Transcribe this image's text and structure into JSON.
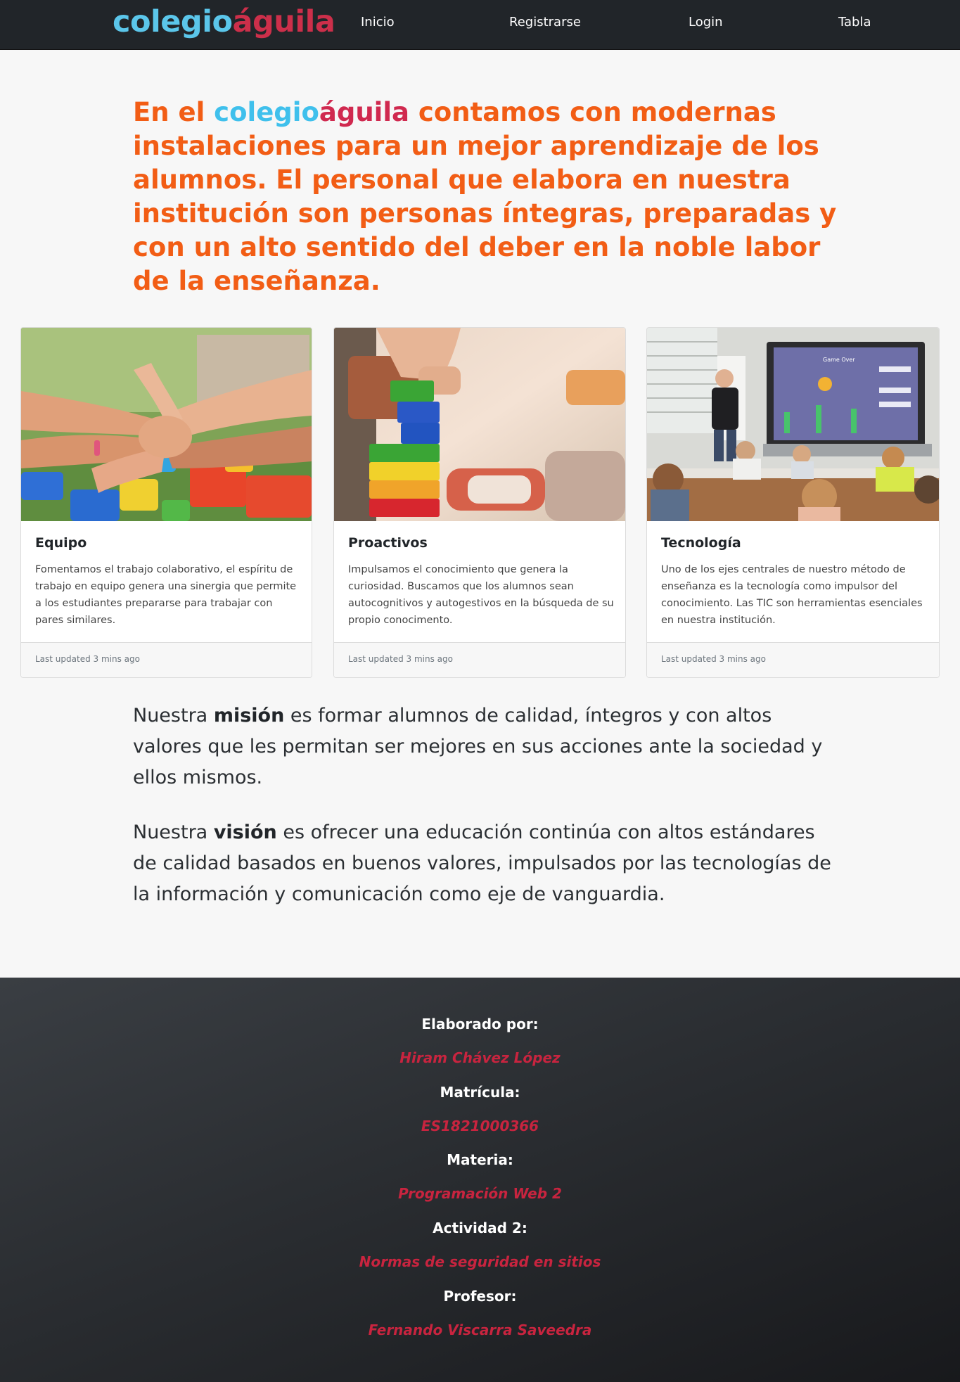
{
  "nav": {
    "brand_part1": "colegio",
    "brand_part2": "águila",
    "links": [
      "Inicio",
      "Registrarse",
      "Login",
      "Tabla"
    ]
  },
  "hero": {
    "prefix": "En el ",
    "brand_part1": "colegio",
    "brand_part2": "águila",
    "text": " contamos con modernas instalaciones para un mejor aprendizaje de los alumnos. El personal que elabora en nuestra institución son personas íntegras, preparadas y con un alto sentido del deber en la noble labor de la enseñanza."
  },
  "cards": [
    {
      "title": "Equipo",
      "text": "Fomentamos el trabajo colaborativo, el espíritu de trabajo en equipo genera una sinergia que permite a los estudiantes prepararse para trabajar con pares similares.",
      "footer": "Last updated 3 mins ago",
      "image": "hands-together-photo"
    },
    {
      "title": "Proactivos",
      "text": "Impulsamos el conocimiento que genera la curiosidad. Buscamos que los alumnos sean autocognitivos y autogestivos en la búsqueda de su propio conocimento.",
      "footer": "Last updated 3 mins ago",
      "image": "building-blocks-photo"
    },
    {
      "title": "Tecnología",
      "text": "Uno de los ejes centrales de nuestro método de enseñanza es la tecnología como impulsor del conocimiento. Las TIC son herramientas esenciales en nuestra institución.",
      "footer": "Last updated 3 mins ago",
      "image": "classroom-smartboard-photo",
      "screen_title": "Game Over"
    }
  ],
  "mission": {
    "prefix": "Nuestra ",
    "keyword": "misión",
    "text": " es formar alumnos de calidad, íntegros y con altos valores que les permitan ser mejores en sus acciones ante la sociedad y ellos mismos."
  },
  "vision": {
    "prefix": "Nuestra ",
    "keyword": "visión",
    "text": " es ofrecer una educación continúa con altos estándares de calidad basados en buenos valores, impulsados por las tecnologías de la información y comunicación como eje de vanguardia."
  },
  "footer": {
    "items": [
      {
        "label": "Elaborado por:",
        "value": "Hiram Chávez López"
      },
      {
        "label": "Matrícula:",
        "value": "ES1821000366"
      },
      {
        "label": "Materia:",
        "value": "Programación Web 2"
      },
      {
        "label": "Actividad 2:",
        "value": "Normas de seguridad en sitios"
      },
      {
        "label": "Profesor:",
        "value": "Fernando Viscarra Saveedra"
      }
    ]
  },
  "colors": {
    "navbar_bg": "#212529",
    "brand_blue": "#5bc6ea",
    "brand_red": "#cc2f4a",
    "hero_orange": "#f25d15",
    "footer_value_red": "#c8243f"
  }
}
